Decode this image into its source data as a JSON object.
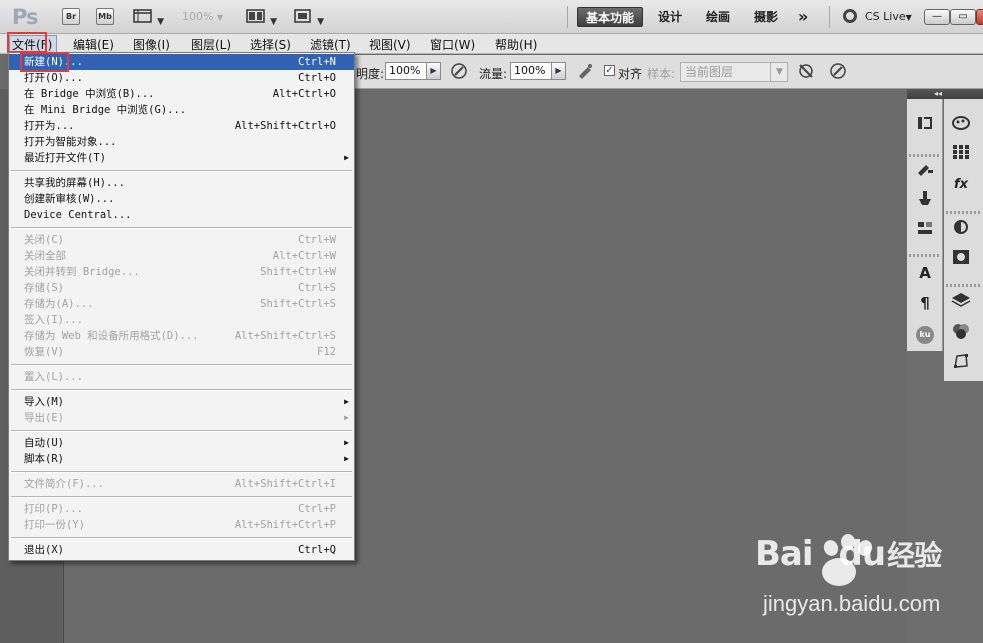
{
  "app_bar": {
    "logo": "Ps",
    "bridge_btn": "Br",
    "minibridge_btn": "Mb",
    "zoom": "100%",
    "workspaces": [
      "基本功能",
      "设计",
      "绘画",
      "摄影"
    ],
    "more": "»",
    "cs_live": "CS Live",
    "window_controls": [
      "—",
      "▭",
      "✕"
    ]
  },
  "menubar": {
    "items": [
      "文件(F)",
      "编辑(E)",
      "图像(I)",
      "图层(L)",
      "选择(S)",
      "滤镜(T)",
      "视图(V)",
      "窗口(W)",
      "帮助(H)"
    ]
  },
  "options_bar": {
    "opacity_label": "明度:",
    "opacity_value": "100%",
    "flow_label": "流量:",
    "flow_value": "100%",
    "align_label": "对齐",
    "align_checked": "✓",
    "sample_label": "样本:",
    "sample_value": "当前图层"
  },
  "file_menu": {
    "items": [
      {
        "label": "新建(N)...",
        "shortcut": "Ctrl+N",
        "selected": true
      },
      {
        "label": "打开(O)...",
        "shortcut": "Ctrl+O"
      },
      {
        "label": "在 Bridge 中浏览(B)...",
        "shortcut": "Alt+Ctrl+O"
      },
      {
        "label": "在 Mini Bridge 中浏览(G)...",
        "shortcut": ""
      },
      {
        "label": "打开为...",
        "shortcut": "Alt+Shift+Ctrl+O"
      },
      {
        "label": "打开为智能对象...",
        "shortcut": ""
      },
      {
        "label": "最近打开文件(T)",
        "shortcut": "",
        "submenu": true
      },
      {
        "separator": true
      },
      {
        "label": "共享我的屏幕(H)...",
        "shortcut": ""
      },
      {
        "label": "创建新审核(W)...",
        "shortcut": ""
      },
      {
        "label": "Device Central...",
        "shortcut": ""
      },
      {
        "separator": true
      },
      {
        "label": "关闭(C)",
        "shortcut": "Ctrl+W",
        "disabled": true
      },
      {
        "label": "关闭全部",
        "shortcut": "Alt+Ctrl+W",
        "disabled": true
      },
      {
        "label": "关闭并转到 Bridge...",
        "shortcut": "Shift+Ctrl+W",
        "disabled": true
      },
      {
        "label": "存储(S)",
        "shortcut": "Ctrl+S",
        "disabled": true
      },
      {
        "label": "存储为(A)...",
        "shortcut": "Shift+Ctrl+S",
        "disabled": true
      },
      {
        "label": "签入(I)...",
        "shortcut": "",
        "disabled": true
      },
      {
        "label": "存储为 Web 和设备所用格式(D)...",
        "shortcut": "Alt+Shift+Ctrl+S",
        "disabled": true
      },
      {
        "label": "恢复(V)",
        "shortcut": "F12",
        "disabled": true
      },
      {
        "separator": true
      },
      {
        "label": "置入(L)...",
        "shortcut": "",
        "disabled": true
      },
      {
        "separator": true
      },
      {
        "label": "导入(M)",
        "shortcut": "",
        "submenu": true
      },
      {
        "label": "导出(E)",
        "shortcut": "",
        "submenu": true,
        "disabled": true
      },
      {
        "separator": true
      },
      {
        "label": "自动(U)",
        "shortcut": "",
        "submenu": true
      },
      {
        "label": "脚本(R)",
        "shortcut": "",
        "submenu": true
      },
      {
        "separator": true
      },
      {
        "label": "文件简介(F)...",
        "shortcut": "Alt+Shift+Ctrl+I",
        "disabled": true
      },
      {
        "separator": true
      },
      {
        "label": "打印(P)...",
        "shortcut": "Ctrl+P",
        "disabled": true
      },
      {
        "label": "打印一份(Y)",
        "shortcut": "Alt+Shift+Ctrl+P",
        "disabled": true
      },
      {
        "separator": true
      },
      {
        "label": "退出(X)",
        "shortcut": "Ctrl+Q"
      }
    ]
  },
  "panel_icons": {
    "col1": [
      "history-icon",
      "brush-presets-icon",
      "clone-source-icon",
      "tool-presets-icon",
      "character-icon",
      "paragraph-icon",
      "kuler-icon"
    ],
    "col2": [
      "color-icon",
      "swatches-icon",
      "styles-icon",
      "adjustments-icon",
      "masks-icon",
      "layers-icon",
      "channels-icon",
      "paths-icon"
    ],
    "kuler_text": "ku"
  },
  "watermark": {
    "brand_left": "Bai",
    "brand_right": "du",
    "brand_cn": "经验",
    "url": "jingyan.baidu.com"
  },
  "colors": {
    "selection": "#3262b2",
    "highlight_box": "#e23b3b",
    "workspace_active": "#4a4a4a"
  }
}
